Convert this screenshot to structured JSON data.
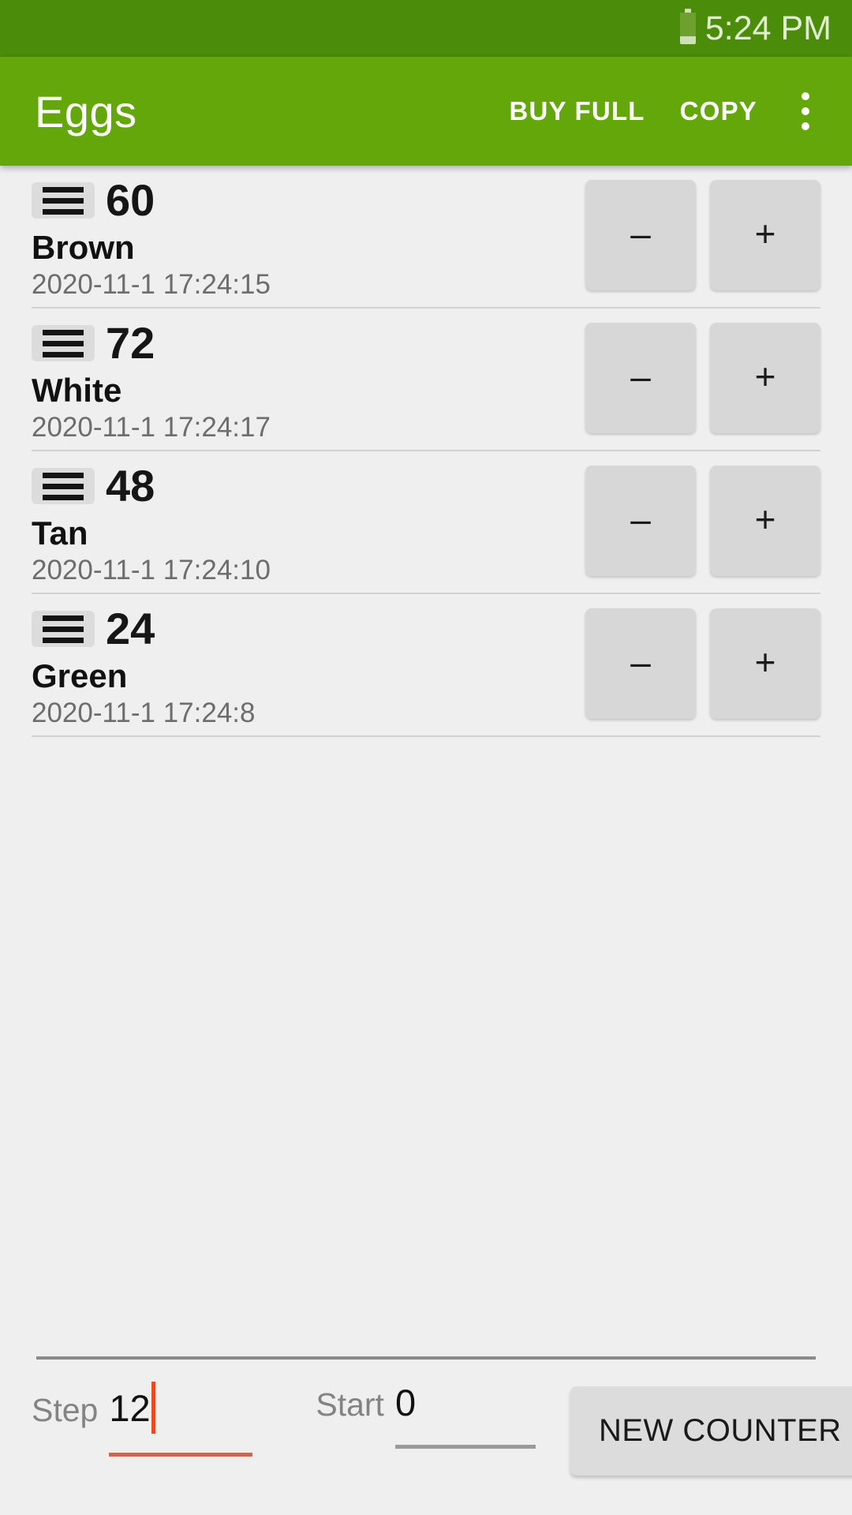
{
  "status_bar": {
    "time": "5:24 PM",
    "battery_icon": "battery-icon",
    "background_color": "#4c8c0b"
  },
  "app_bar": {
    "title": "Eggs",
    "buy_full_label": "BUY FULL",
    "copy_label": "COPY",
    "overflow_icon": "more-vertical-icon",
    "background_color": "#64a70b",
    "text_color": "#ffffff"
  },
  "counters": [
    {
      "drag_icon": "drag-handle-icon",
      "count": "60",
      "name": "Brown",
      "timestamp": "2020-11-1 17:24:15",
      "decrement_label": "–",
      "increment_label": "+"
    },
    {
      "drag_icon": "drag-handle-icon",
      "count": "72",
      "name": "White",
      "timestamp": "2020-11-1 17:24:17",
      "decrement_label": "–",
      "increment_label": "+"
    },
    {
      "drag_icon": "drag-handle-icon",
      "count": "48",
      "name": "Tan",
      "timestamp": "2020-11-1 17:24:10",
      "decrement_label": "–",
      "increment_label": "+"
    },
    {
      "drag_icon": "drag-handle-icon",
      "count": "24",
      "name": "Green",
      "timestamp": "2020-11-1 17:24:8",
      "decrement_label": "–",
      "increment_label": "+"
    }
  ],
  "bottom_bar": {
    "step": {
      "label": "Step",
      "value": "12",
      "focused": true,
      "underline_color": "#d9604d",
      "caret_color": "#ec4a1e"
    },
    "start": {
      "label": "Start",
      "value": "0",
      "focused": false,
      "underline_color": "#9a9a9a"
    },
    "new_counter_label": "NEW COUNTER"
  }
}
